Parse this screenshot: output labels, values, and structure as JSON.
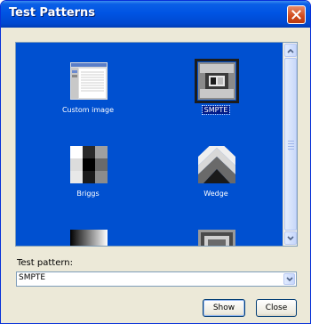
{
  "window": {
    "title": "Test Patterns",
    "close_icon": "close-icon"
  },
  "patterns": {
    "items": [
      {
        "label": "Custom image",
        "icon": "custom-image-thumbnail"
      },
      {
        "label": "SMPTE",
        "icon": "smpte-thumbnail",
        "selected": true
      },
      {
        "label": "Briggs",
        "icon": "briggs-thumbnail"
      },
      {
        "label": "Wedge",
        "icon": "wedge-thumbnail"
      },
      {
        "label": "",
        "icon": "gradient-thumbnail"
      },
      {
        "label": "",
        "icon": "frame-thumbnail"
      }
    ]
  },
  "field": {
    "label": "Test pattern:",
    "value": "SMPTE"
  },
  "buttons": {
    "show": "Show",
    "close": "Close"
  },
  "colors": {
    "list_background": "#0050d0",
    "title_bar": "#0054e3",
    "dialog": "#ece9d8"
  }
}
